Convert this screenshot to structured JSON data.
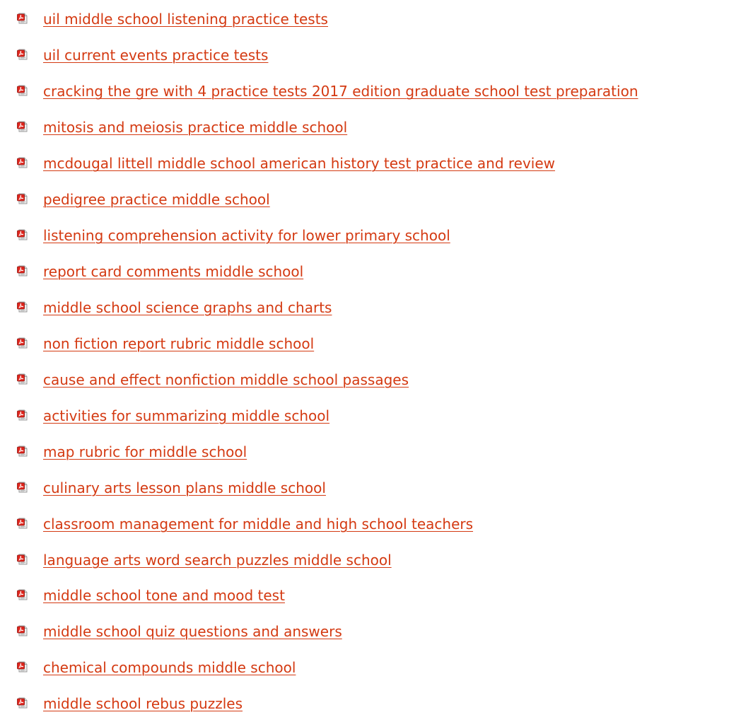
{
  "colors": {
    "link": "#d43a12",
    "icon_red": "#e0251c",
    "icon_page": "#eeeeee"
  },
  "list": {
    "icon_name": "pdf-file-icon",
    "items": [
      {
        "label": "uil middle school listening practice tests"
      },
      {
        "label": "uil current events practice tests"
      },
      {
        "label": "cracking the gre with 4 practice tests 2017 edition graduate school test preparation"
      },
      {
        "label": "mitosis and meiosis practice middle school"
      },
      {
        "label": "mcdougal littell middle school american history test practice and review"
      },
      {
        "label": "pedigree practice middle school"
      },
      {
        "label": "listening comprehension activity for lower primary school"
      },
      {
        "label": "report card comments middle school"
      },
      {
        "label": "middle school science graphs and charts"
      },
      {
        "label": "non fiction report rubric middle school"
      },
      {
        "label": "cause and effect nonfiction middle school passages"
      },
      {
        "label": "activities for summarizing middle school"
      },
      {
        "label": "map rubric for middle school"
      },
      {
        "label": "culinary arts lesson plans middle school"
      },
      {
        "label": "classroom management for middle and high school teachers"
      },
      {
        "label": "language arts word search puzzles middle school"
      },
      {
        "label": "middle school tone and mood test"
      },
      {
        "label": "middle school quiz questions and answers"
      },
      {
        "label": "chemical compounds middle school"
      },
      {
        "label": "middle school rebus puzzles"
      }
    ]
  }
}
